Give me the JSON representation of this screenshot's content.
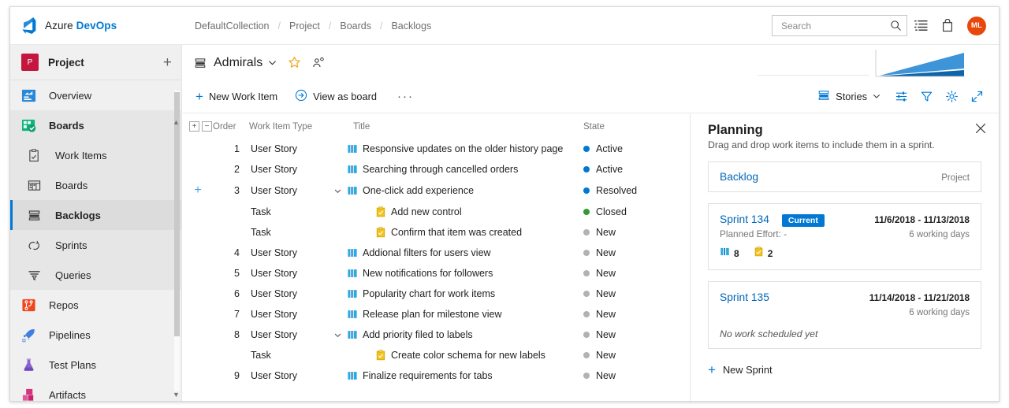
{
  "brand": {
    "azure": "Azure",
    "devops": "DevOps",
    "logo_icon": "azure-devops-logo-icon"
  },
  "breadcrumb": {
    "items": [
      "DefaultCollection",
      "Project",
      "Boards",
      "Backlogs"
    ],
    "separator": "/"
  },
  "topbar": {
    "search": {
      "placeholder": "Search",
      "value": "",
      "icon": "search-icon"
    },
    "icons": [
      {
        "name": "work-items-icon",
        "glyph": "list"
      },
      {
        "name": "marketplace-bag-icon",
        "glyph": "bag"
      }
    ],
    "avatar": {
      "initials": "ML",
      "color": "#e8480c"
    }
  },
  "sidebar": {
    "project": {
      "badge": "P",
      "name": "Project",
      "badge_color": "#c4163f",
      "add_icon": "plus-icon"
    },
    "items": [
      {
        "label": "Overview",
        "icon": "overview-icon",
        "state": "normal"
      },
      {
        "label": "Boards",
        "icon": "boards-hub-icon",
        "state": "group"
      },
      {
        "label": "Work Items",
        "icon": "work-items-icon",
        "state": "shaded"
      },
      {
        "label": "Boards",
        "icon": "board-icon",
        "state": "shaded"
      },
      {
        "label": "Backlogs",
        "icon": "backlogs-icon",
        "state": "active"
      },
      {
        "label": "Sprints",
        "icon": "sprints-icon",
        "state": "shaded"
      },
      {
        "label": "Queries",
        "icon": "queries-icon",
        "state": "shaded"
      },
      {
        "label": "Repos",
        "icon": "repos-icon",
        "state": "normal"
      },
      {
        "label": "Pipelines",
        "icon": "pipelines-icon",
        "state": "normal"
      },
      {
        "label": "Test Plans",
        "icon": "test-plans-icon",
        "state": "normal"
      },
      {
        "label": "Artifacts",
        "icon": "artifacts-icon",
        "state": "normal"
      }
    ]
  },
  "hub": {
    "title": "Admirals",
    "icon": "backlogs-icon",
    "chevron_icon": "chevron-down-icon",
    "favorite_icon": "star-icon",
    "team_icon": "team-members-icon"
  },
  "commandbar": {
    "new_work_item": "New Work Item",
    "new_work_item_icon": "plus-icon",
    "view_as_board": "View as board",
    "view_as_board_icon": "arrow-circle-right-icon",
    "more_icon": "ellipsis-icon",
    "level": "Stories",
    "level_icon": "backlogs-icon",
    "level_chevron_icon": "chevron-down-icon",
    "column_options_icon": "column-options-icon",
    "filter_icon": "filter-icon",
    "settings_icon": "gear-icon",
    "fullscreen_icon": "expand-icon"
  },
  "grid": {
    "expand_all_icon": "expand-all-icon",
    "collapse_all_icon": "collapse-all-icon",
    "columns": [
      "Order",
      "Work Item Type",
      "Title",
      "State"
    ],
    "rows": [
      {
        "order": "1",
        "type": "User Story",
        "title": "Responsive updates on the older history page",
        "state": "Active",
        "state_color": "#0078d4",
        "icon": "user-story-icon",
        "indent": 0,
        "chevron": "",
        "row_add": false
      },
      {
        "order": "2",
        "type": "User Story",
        "title": "Searching through cancelled orders",
        "state": "Active",
        "state_color": "#0078d4",
        "icon": "user-story-icon",
        "indent": 0,
        "chevron": "",
        "row_add": false
      },
      {
        "order": "3",
        "type": "User Story",
        "title": "One-click add experience",
        "state": "Resolved",
        "state_color": "#0078d4",
        "icon": "user-story-icon",
        "indent": 0,
        "chevron": "down",
        "row_add": true
      },
      {
        "order": "",
        "type": "Task",
        "title": "Add new control",
        "state": "Closed",
        "state_color": "#339933",
        "icon": "task-icon",
        "indent": 1,
        "chevron": "",
        "row_add": false
      },
      {
        "order": "",
        "type": "Task",
        "title": "Confirm that item was created",
        "state": "New",
        "state_color": "#b2b2b2",
        "icon": "task-icon",
        "indent": 1,
        "chevron": "",
        "row_add": false
      },
      {
        "order": "4",
        "type": "User Story",
        "title": "Addional filters for users view",
        "state": "New",
        "state_color": "#b2b2b2",
        "icon": "user-story-icon",
        "indent": 0,
        "chevron": "",
        "row_add": false
      },
      {
        "order": "5",
        "type": "User Story",
        "title": "New notifications for followers",
        "state": "New",
        "state_color": "#b2b2b2",
        "icon": "user-story-icon",
        "indent": 0,
        "chevron": "",
        "row_add": false
      },
      {
        "order": "6",
        "type": "User Story",
        "title": "Popularity chart for work items",
        "state": "New",
        "state_color": "#b2b2b2",
        "icon": "user-story-icon",
        "indent": 0,
        "chevron": "",
        "row_add": false
      },
      {
        "order": "7",
        "type": "User Story",
        "title": "Release plan for milestone view",
        "state": "New",
        "state_color": "#b2b2b2",
        "icon": "user-story-icon",
        "indent": 0,
        "chevron": "",
        "row_add": false
      },
      {
        "order": "8",
        "type": "User Story",
        "title": "Add priority filed to labels",
        "state": "New",
        "state_color": "#b2b2b2",
        "icon": "user-story-icon",
        "indent": 0,
        "chevron": "down",
        "row_add": false
      },
      {
        "order": "",
        "type": "Task",
        "title": "Create color schema for new labels",
        "state": "New",
        "state_color": "#b2b2b2",
        "icon": "task-icon",
        "indent": 1,
        "chevron": "",
        "row_add": false
      },
      {
        "order": "9",
        "type": "User Story",
        "title": "Finalize requirements for tabs",
        "state": "New",
        "state_color": "#b2b2b2",
        "icon": "user-story-icon",
        "indent": 0,
        "chevron": "",
        "row_add": false
      }
    ]
  },
  "planning": {
    "title": "Planning",
    "subtitle": "Drag and drop work items to include them in a sprint.",
    "close_icon": "close-icon",
    "backlog": {
      "name": "Backlog",
      "scope": "Project"
    },
    "sprints": [
      {
        "name": "Sprint 134",
        "badge": "Current",
        "dates": "11/6/2018 - 11/13/2018",
        "working_days": "6 working days",
        "planned_effort": "Planned Effort: -",
        "note": "",
        "counts": [
          {
            "icon": "user-story-icon",
            "value": "8"
          },
          {
            "icon": "task-icon",
            "value": "2"
          }
        ]
      },
      {
        "name": "Sprint 135",
        "badge": "",
        "dates": "11/14/2018 - 11/21/2018",
        "working_days": "6 working days",
        "planned_effort": "",
        "note": "No work scheduled yet",
        "counts": []
      }
    ],
    "new_sprint": {
      "label": "New Sprint",
      "icon": "plus-icon"
    }
  },
  "colors": {
    "accent": "#0078d4",
    "link": "#0067b8",
    "state_active": "#0078d4",
    "state_closed": "#339933",
    "state_new": "#b2b2b2",
    "avatar": "#e8480c",
    "project_badge": "#c4163f"
  }
}
